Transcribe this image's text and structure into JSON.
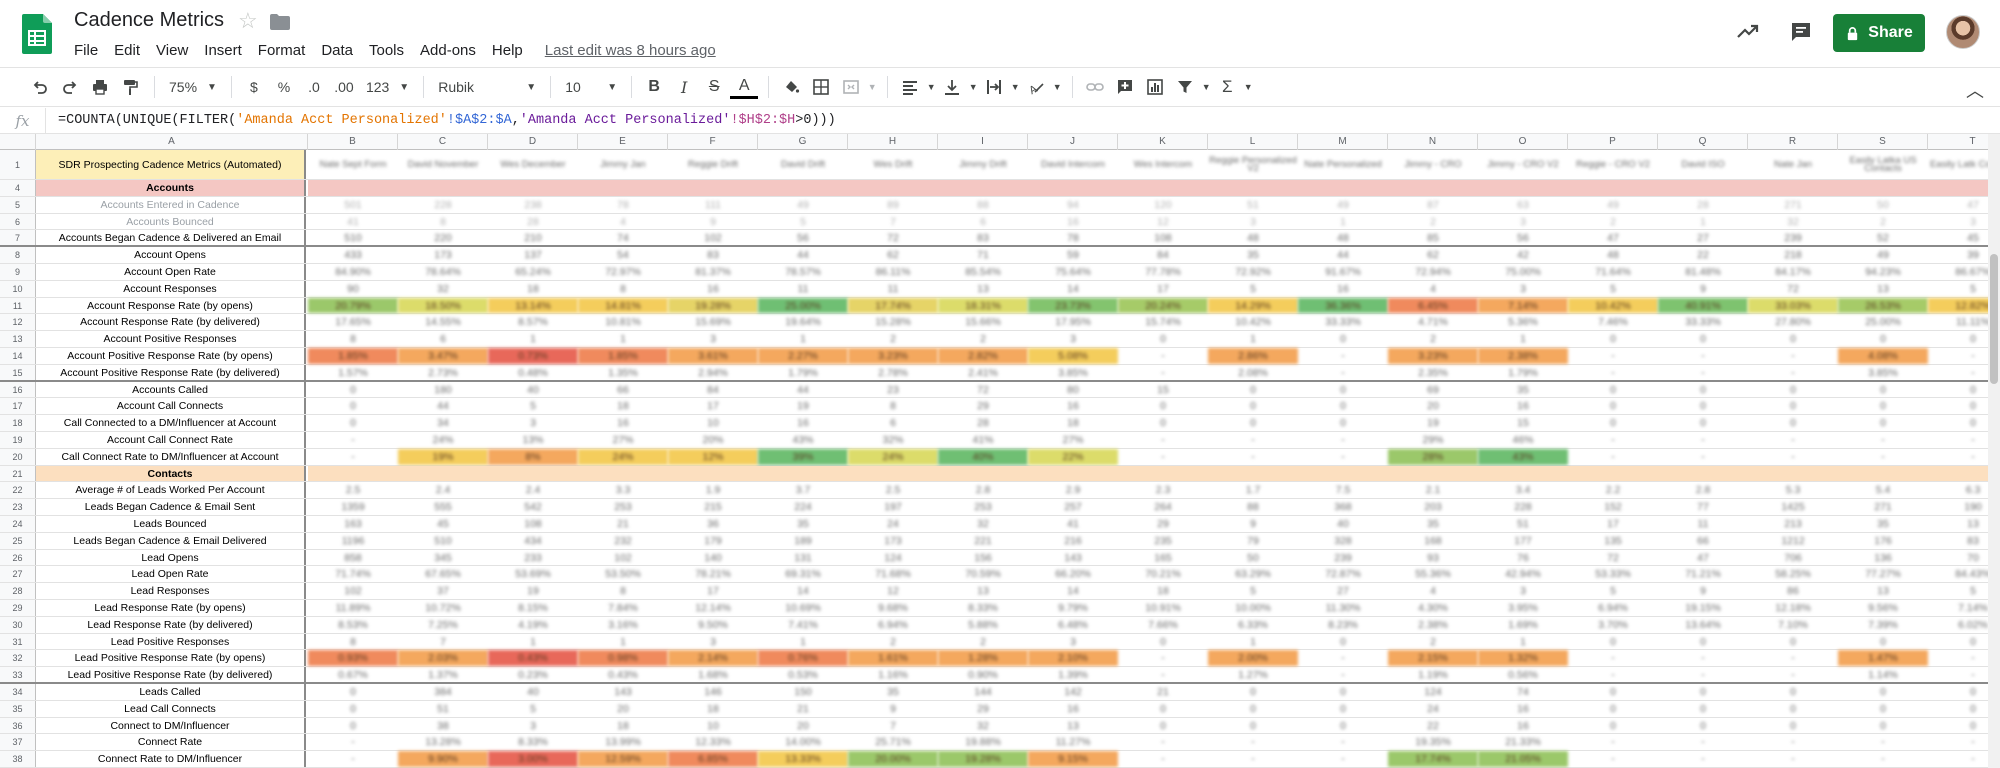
{
  "app": {
    "title": "Cadence Metrics",
    "last_edit": "Last edit was 8 hours ago",
    "share_label": "Share"
  },
  "menu": [
    "File",
    "Edit",
    "View",
    "Insert",
    "Format",
    "Data",
    "Tools",
    "Add-ons",
    "Help"
  ],
  "toolbar": {
    "zoom": "75%",
    "currency": "$",
    "percent": "%",
    "dec_decrease": ".0",
    "dec_increase": ".00",
    "number_format": "123",
    "font": "Rubik",
    "font_size": "10",
    "bold": "B",
    "italic": "I",
    "strike": "S",
    "text_color": "A"
  },
  "formula_bar": {
    "fx": "fx",
    "formula_parts": [
      {
        "t": "=COUNTA(UNIQUE(FILTER(",
        "c": "f-fn"
      },
      {
        "t": "'Amanda Acct Personalized'",
        "c": "f-s1"
      },
      {
        "t": "!$A$2:$A",
        "c": "f-r1"
      },
      {
        "t": ",",
        "c": "f-fn"
      },
      {
        "t": "'Amanda Acct Personalized'",
        "c": "f-s2"
      },
      {
        "t": "!$H$2:$H",
        "c": "f-r2"
      },
      {
        "t": ">0)))",
        "c": "f-fn"
      }
    ]
  },
  "columns": [
    "A",
    "B",
    "C",
    "D",
    "E",
    "F",
    "G",
    "H",
    "I",
    "J",
    "K",
    "L",
    "M",
    "N",
    "O",
    "P",
    "Q",
    "R",
    "S",
    "T"
  ],
  "column_headers": [
    "Nate Sept Form",
    "David November",
    "Wes December",
    "Jimmy Jan",
    "Reggie Drift",
    "David Drift",
    "Wes Drift",
    "Jimmy Drift",
    "David Intercom",
    "Wes Intercom",
    "Reggie Personalized V2",
    "Nate Personalized",
    "Jimmy - CRO",
    "Jimmy - CRO V2",
    "Reggie - CRO V2",
    "David ISO",
    "Nate Jan",
    "Easily Latka US Contacts",
    "Easily Latk Contacts"
  ],
  "rows": [
    {
      "n": "1",
      "label": "SDR Prospecting Cadence Metrics (Automated)",
      "style": "hdr",
      "cells": []
    },
    {
      "n": "4",
      "label": "Accounts",
      "style": "sec1",
      "band": "#f4c7c3",
      "cells": []
    },
    {
      "n": "5",
      "label": "Accounts Entered in Cadence",
      "style": "gray",
      "cells": [
        "501",
        "228",
        "238",
        "78",
        "111",
        "49",
        "89",
        "88",
        "94",
        "120",
        "51",
        "49",
        "87",
        "63",
        "49",
        "28",
        "271",
        "50",
        "47"
      ]
    },
    {
      "n": "6",
      "label": "Accounts Bounced",
      "style": "gray",
      "cells": [
        "41",
        "8",
        "28",
        "4",
        "9",
        "5",
        "7",
        "6",
        "16",
        "12",
        "3",
        "1",
        "2",
        "3",
        "2",
        "1",
        "32",
        "2",
        "3"
      ]
    },
    {
      "n": "7",
      "label": "Accounts Began Cadence & Delivered an Email",
      "style": "",
      "thick": true,
      "cells": [
        "510",
        "220",
        "210",
        "74",
        "102",
        "56",
        "72",
        "83",
        "78",
        "108",
        "48",
        "48",
        "85",
        "56",
        "47",
        "27",
        "239",
        "52",
        "45"
      ]
    },
    {
      "n": "8",
      "label": "Account Opens",
      "style": "",
      "cells": [
        "433",
        "173",
        "137",
        "54",
        "83",
        "44",
        "62",
        "71",
        "59",
        "84",
        "35",
        "44",
        "62",
        "42",
        "48",
        "22",
        "218",
        "49",
        "39"
      ]
    },
    {
      "n": "9",
      "label": "Account Open Rate",
      "style": "",
      "cells": [
        "84.90%",
        "78.64%",
        "65.24%",
        "72.97%",
        "81.37%",
        "78.57%",
        "86.11%",
        "85.54%",
        "75.64%",
        "77.78%",
        "72.92%",
        "91.67%",
        "72.94%",
        "75.00%",
        "71.64%",
        "81.48%",
        "84.17%",
        "94.23%",
        "86.67%"
      ]
    },
    {
      "n": "10",
      "label": "Account Responses",
      "style": "",
      "cells": [
        "90",
        "32",
        "18",
        "8",
        "16",
        "11",
        "11",
        "13",
        "14",
        "17",
        "5",
        "16",
        "4",
        "3",
        "5",
        "9",
        "72",
        "13",
        "5"
      ]
    },
    {
      "n": "11",
      "label": "Account Response Rate (by opens)",
      "style": "",
      "colors": [
        "#9bc86a",
        "#dcdc6a",
        "#f4cd5c",
        "#f4cd5c",
        "#e6d467",
        "#6fbf73",
        "#e6d467",
        "#dcdc6a",
        "#83c46e",
        "#a6cb68",
        "#f4cd5c",
        "#6fbf73",
        "#f08a5d",
        "#f4a85e",
        "#f4cd5c",
        "#7ec36f",
        "#dcdc6a",
        "#a6cb68",
        "#f4cd5c"
      ],
      "cells": [
        "20.79%",
        "18.50%",
        "13.14%",
        "14.81%",
        "19.28%",
        "25.00%",
        "17.74%",
        "18.31%",
        "23.73%",
        "20.24%",
        "14.29%",
        "36.36%",
        "6.45%",
        "7.14%",
        "10.42%",
        "40.91%",
        "33.03%",
        "26.53%",
        "12.82%"
      ]
    },
    {
      "n": "12",
      "label": "Account Response Rate (by delivered)",
      "style": "",
      "cells": [
        "17.65%",
        "14.55%",
        "8.57%",
        "10.81%",
        "15.69%",
        "19.64%",
        "15.28%",
        "15.66%",
        "17.95%",
        "15.74%",
        "10.42%",
        "33.33%",
        "4.71%",
        "5.36%",
        "7.46%",
        "33.33%",
        "27.80%",
        "25.00%",
        "11.11%"
      ]
    },
    {
      "n": "13",
      "label": "Account Positive Responses",
      "style": "",
      "cells": [
        "8",
        "6",
        "1",
        "1",
        "3",
        "1",
        "2",
        "2",
        "3",
        "0",
        "1",
        "0",
        "2",
        "1",
        "0",
        "0",
        "0",
        "0",
        "0"
      ]
    },
    {
      "n": "14",
      "label": "Account Positive Response Rate (by opens)",
      "style": "",
      "colors": [
        "#f08a5d",
        "#f4a85e",
        "#e8685a",
        "#f08a5d",
        "#f4a85e",
        "#f4a85e",
        "#f4a85e",
        "#f4a85e",
        "#f4cd5c",
        "",
        "#f4a85e",
        "",
        "#f4a85e",
        "#f4a85e",
        "",
        "",
        "",
        "#f4a85e",
        ""
      ],
      "cells": [
        "1.85%",
        "3.47%",
        "0.73%",
        "1.85%",
        "3.61%",
        "2.27%",
        "3.23%",
        "2.82%",
        "5.08%",
        "-",
        "2.86%",
        "-",
        "3.23%",
        "2.38%",
        "-",
        "-",
        "-",
        "4.08%",
        "-"
      ]
    },
    {
      "n": "15",
      "label": "Account Positive Response Rate (by delivered)",
      "style": "",
      "thick": true,
      "cells": [
        "1.57%",
        "2.73%",
        "0.48%",
        "1.35%",
        "2.94%",
        "1.79%",
        "2.78%",
        "2.41%",
        "3.85%",
        "-",
        "2.08%",
        "-",
        "2.35%",
        "1.79%",
        "-",
        "-",
        "-",
        "3.85%",
        "-"
      ]
    },
    {
      "n": "16",
      "label": "Accounts Called",
      "style": "",
      "cells": [
        "0",
        "180",
        "40",
        "66",
        "84",
        "44",
        "23",
        "72",
        "80",
        "15",
        "0",
        "0",
        "69",
        "35",
        "0",
        "0",
        "0",
        "0",
        "0"
      ]
    },
    {
      "n": "17",
      "label": "Account Call Connects",
      "style": "",
      "cells": [
        "0",
        "44",
        "5",
        "18",
        "17",
        "19",
        "8",
        "29",
        "16",
        "0",
        "0",
        "0",
        "20",
        "16",
        "0",
        "0",
        "0",
        "0",
        "0"
      ]
    },
    {
      "n": "18",
      "label": "Call Connected to a DM/Influencer at Account",
      "style": "",
      "cells": [
        "0",
        "34",
        "3",
        "16",
        "10",
        "16",
        "6",
        "28",
        "18",
        "0",
        "0",
        "0",
        "19",
        "15",
        "0",
        "0",
        "0",
        "0",
        "0"
      ]
    },
    {
      "n": "19",
      "label": "Account Call Connect Rate",
      "style": "",
      "cells": [
        "-",
        "24%",
        "13%",
        "27%",
        "20%",
        "43%",
        "32%",
        "41%",
        "27%",
        "-",
        "-",
        "-",
        "29%",
        "46%",
        "-",
        "-",
        "-",
        "-",
        "-"
      ]
    },
    {
      "n": "20",
      "label": "Call Connect Rate to DM/Influencer at Account",
      "style": "",
      "colors": [
        "",
        "#f4cd5c",
        "#f4a85e",
        "#f4cd5c",
        "#f4cd5c",
        "#6fbf73",
        "#dcdc6a",
        "#6fbf73",
        "#dcdc6a",
        "",
        "",
        "",
        "#9bc86a",
        "#6fbf73",
        "",
        "",
        "",
        "",
        ""
      ],
      "cells": [
        "-",
        "19%",
        "8%",
        "24%",
        "12%",
        "39%",
        "24%",
        "40%",
        "22%",
        "-",
        "-",
        "-",
        "28%",
        "43%",
        "-",
        "-",
        "-",
        "-",
        "-"
      ]
    },
    {
      "n": "21",
      "label": "Contacts",
      "style": "sec2",
      "band": "#fcdfbf",
      "cells": []
    },
    {
      "n": "22",
      "label": "Average # of Leads Worked Per Account",
      "style": "",
      "cells": [
        "2.5",
        "2.4",
        "2.4",
        "3.3",
        "1.9",
        "3.7",
        "2.5",
        "2.8",
        "2.9",
        "2.3",
        "1.7",
        "7.5",
        "2.1",
        "3.4",
        "2.2",
        "2.8",
        "5.3",
        "5.4",
        "6.3"
      ]
    },
    {
      "n": "23",
      "label": "Leads Began Cadence & Email Sent",
      "style": "",
      "cells": [
        "1359",
        "555",
        "542",
        "253",
        "215",
        "224",
        "197",
        "253",
        "257",
        "264",
        "88",
        "368",
        "203",
        "228",
        "152",
        "77",
        "1425",
        "271",
        "190"
      ]
    },
    {
      "n": "24",
      "label": "Leads Bounced",
      "style": "",
      "cells": [
        "163",
        "45",
        "108",
        "21",
        "36",
        "35",
        "24",
        "32",
        "41",
        "29",
        "9",
        "40",
        "35",
        "51",
        "17",
        "11",
        "213",
        "35",
        "13"
      ]
    },
    {
      "n": "25",
      "label": "Leads Began Cadence & Email Delivered",
      "style": "",
      "cells": [
        "1196",
        "510",
        "434",
        "232",
        "179",
        "189",
        "173",
        "221",
        "216",
        "235",
        "79",
        "328",
        "168",
        "177",
        "135",
        "66",
        "1212",
        "176",
        "83"
      ]
    },
    {
      "n": "26",
      "label": "Lead Opens",
      "style": "",
      "cells": [
        "858",
        "345",
        "233",
        "102",
        "140",
        "131",
        "124",
        "156",
        "143",
        "165",
        "50",
        "239",
        "93",
        "76",
        "72",
        "47",
        "706",
        "136",
        "70"
      ]
    },
    {
      "n": "27",
      "label": "Lead Open Rate",
      "style": "",
      "cells": [
        "71.74%",
        "67.65%",
        "53.69%",
        "53.50%",
        "78.21%",
        "69.31%",
        "71.68%",
        "70.59%",
        "66.20%",
        "70.21%",
        "63.29%",
        "72.87%",
        "55.36%",
        "42.94%",
        "53.33%",
        "71.21%",
        "58.25%",
        "77.27%",
        "84.43%"
      ]
    },
    {
      "n": "28",
      "label": "Lead Responses",
      "style": "",
      "cells": [
        "102",
        "37",
        "19",
        "8",
        "17",
        "14",
        "12",
        "13",
        "14",
        "18",
        "5",
        "27",
        "4",
        "3",
        "5",
        "9",
        "86",
        "13",
        "5"
      ]
    },
    {
      "n": "29",
      "label": "Lead Response Rate (by opens)",
      "style": "",
      "cells": [
        "11.89%",
        "10.72%",
        "8.15%",
        "7.84%",
        "12.14%",
        "10.69%",
        "9.68%",
        "8.33%",
        "9.79%",
        "10.91%",
        "10.00%",
        "11.30%",
        "4.30%",
        "3.95%",
        "6.94%",
        "19.15%",
        "12.18%",
        "9.56%",
        "7.14%"
      ]
    },
    {
      "n": "30",
      "label": "Lead Response Rate (by delivered)",
      "style": "",
      "cells": [
        "8.53%",
        "7.25%",
        "4.19%",
        "3.16%",
        "9.50%",
        "7.41%",
        "6.94%",
        "5.88%",
        "6.48%",
        "7.66%",
        "6.33%",
        "8.23%",
        "2.38%",
        "1.69%",
        "3.70%",
        "13.64%",
        "7.10%",
        "7.39%",
        "6.02%"
      ]
    },
    {
      "n": "31",
      "label": "Lead Positive Responses",
      "style": "",
      "cells": [
        "8",
        "7",
        "1",
        "1",
        "3",
        "1",
        "2",
        "2",
        "3",
        "0",
        "1",
        "0",
        "2",
        "1",
        "0",
        "0",
        "0",
        "0",
        "0"
      ]
    },
    {
      "n": "32",
      "label": "Lead Positive Response Rate (by opens)",
      "style": "",
      "colors": [
        "#f08a5d",
        "#f4a85e",
        "#e8685a",
        "#f08a5d",
        "#f4a85e",
        "#f08a5d",
        "#f4a85e",
        "#f4a85e",
        "#f4a85e",
        "",
        "#f4a85e",
        "",
        "#f4a85e",
        "#f4a85e",
        "",
        "",
        "",
        "#f4a85e",
        ""
      ],
      "cells": [
        "0.93%",
        "2.03%",
        "0.43%",
        "0.98%",
        "2.14%",
        "0.76%",
        "1.61%",
        "1.28%",
        "2.10%",
        "-",
        "2.00%",
        "-",
        "2.15%",
        "1.32%",
        "-",
        "-",
        "-",
        "1.47%",
        "-"
      ]
    },
    {
      "n": "33",
      "label": "Lead Positive Response Rate (by delivered)",
      "style": "",
      "thick": true,
      "cells": [
        "0.67%",
        "1.37%",
        "0.23%",
        "0.43%",
        "1.68%",
        "0.53%",
        "1.16%",
        "0.90%",
        "1.39%",
        "-",
        "1.27%",
        "-",
        "1.19%",
        "0.56%",
        "-",
        "-",
        "-",
        "1.14%",
        "-"
      ]
    },
    {
      "n": "34",
      "label": "Leads Called",
      "style": "",
      "cells": [
        "0",
        "384",
        "40",
        "143",
        "146",
        "150",
        "35",
        "144",
        "142",
        "21",
        "0",
        "0",
        "124",
        "74",
        "0",
        "0",
        "0",
        "0",
        "0"
      ]
    },
    {
      "n": "35",
      "label": "Lead Call Connects",
      "style": "",
      "cells": [
        "0",
        "51",
        "5",
        "20",
        "18",
        "21",
        "9",
        "29",
        "16",
        "0",
        "0",
        "0",
        "24",
        "16",
        "0",
        "0",
        "0",
        "0",
        "0"
      ]
    },
    {
      "n": "36",
      "label": "Connect to DM/Influencer",
      "style": "",
      "cells": [
        "0",
        "38",
        "3",
        "18",
        "10",
        "20",
        "7",
        "32",
        "13",
        "0",
        "0",
        "0",
        "22",
        "16",
        "0",
        "0",
        "0",
        "0",
        "0"
      ]
    },
    {
      "n": "37",
      "label": "Connect Rate",
      "style": "",
      "cells": [
        "-",
        "13.28%",
        "8.33%",
        "13.99%",
        "12.33%",
        "14.00%",
        "25.71%",
        "19.88%",
        "11.27%",
        "-",
        "-",
        "-",
        "19.35%",
        "21.33%",
        "-",
        "-",
        "-",
        "-",
        "-"
      ]
    },
    {
      "n": "38",
      "label": "Connect Rate to DM/Influencer",
      "style": "",
      "colors": [
        "",
        "#f4a85e",
        "#e8685a",
        "#f4a85e",
        "#f08a5d",
        "#f4cd5c",
        "#9bc86a",
        "#9bc86a",
        "#f4a85e",
        "",
        "",
        "",
        "#9bc86a",
        "#9bc86a",
        "",
        "",
        "",
        "",
        ""
      ],
      "cells": [
        "-",
        "9.90%",
        "3.00%",
        "12.59%",
        "6.85%",
        "13.33%",
        "20.00%",
        "19.28%",
        "9.15%",
        "-",
        "-",
        "-",
        "17.74%",
        "21.05%",
        "-",
        "-",
        "-",
        "-",
        "-"
      ]
    }
  ]
}
